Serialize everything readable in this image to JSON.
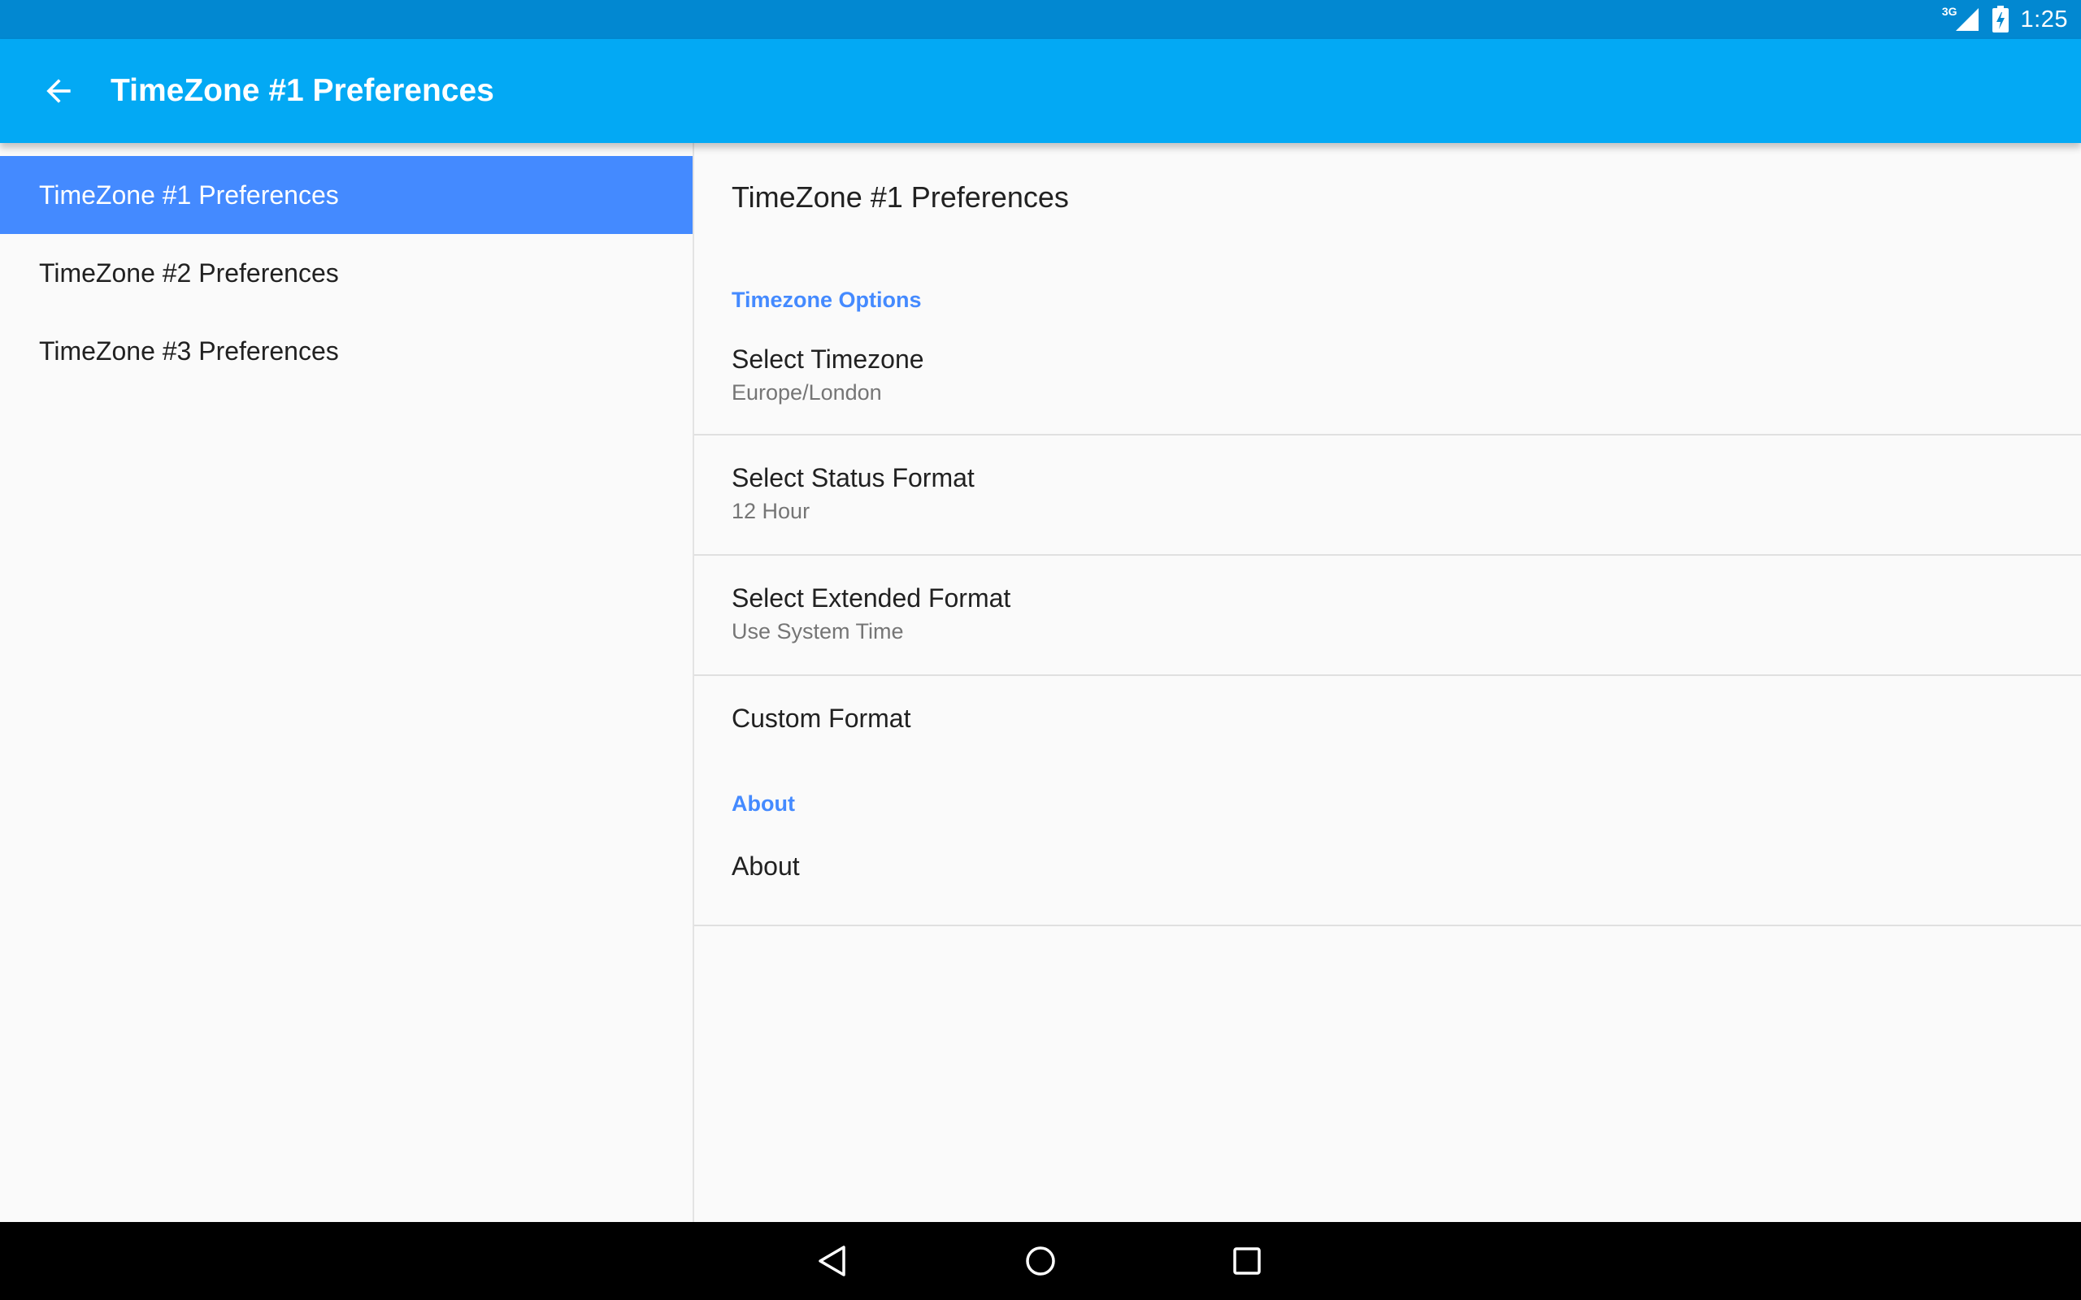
{
  "status_bar": {
    "network_type": "3G",
    "time": "1:25",
    "icons": [
      "signal-icon",
      "battery-icon"
    ]
  },
  "app_bar": {
    "title": "TimeZone #1 Preferences",
    "nav_icon": "arrow-back-icon"
  },
  "headers": [
    {
      "label": "TimeZone #1 Preferences",
      "selected": true
    },
    {
      "label": "TimeZone #2 Preferences",
      "selected": false
    },
    {
      "label": "TimeZone #3 Preferences",
      "selected": false
    }
  ],
  "detail": {
    "title": "TimeZone #1 Preferences",
    "categories": [
      {
        "title": "Timezone Options",
        "preferences": [
          {
            "title": "Select Timezone",
            "summary": "Europe/London"
          },
          {
            "title": "Select Status Format",
            "summary": "12 Hour"
          },
          {
            "title": "Select Extended Format",
            "summary": "Use System Time"
          },
          {
            "title": "Custom Format",
            "summary": ""
          }
        ]
      },
      {
        "title": "About",
        "preferences": [
          {
            "title": "About",
            "summary": ""
          }
        ]
      }
    ]
  },
  "nav_bar": {
    "buttons": [
      "back-triangle-icon",
      "home-circle-icon",
      "recents-square-icon"
    ]
  },
  "colors": {
    "status_bar": "#0288d1",
    "app_bar": "#03a9f4",
    "accent": "#448aff",
    "background": "#fafafa",
    "nav_bar": "#000000"
  }
}
